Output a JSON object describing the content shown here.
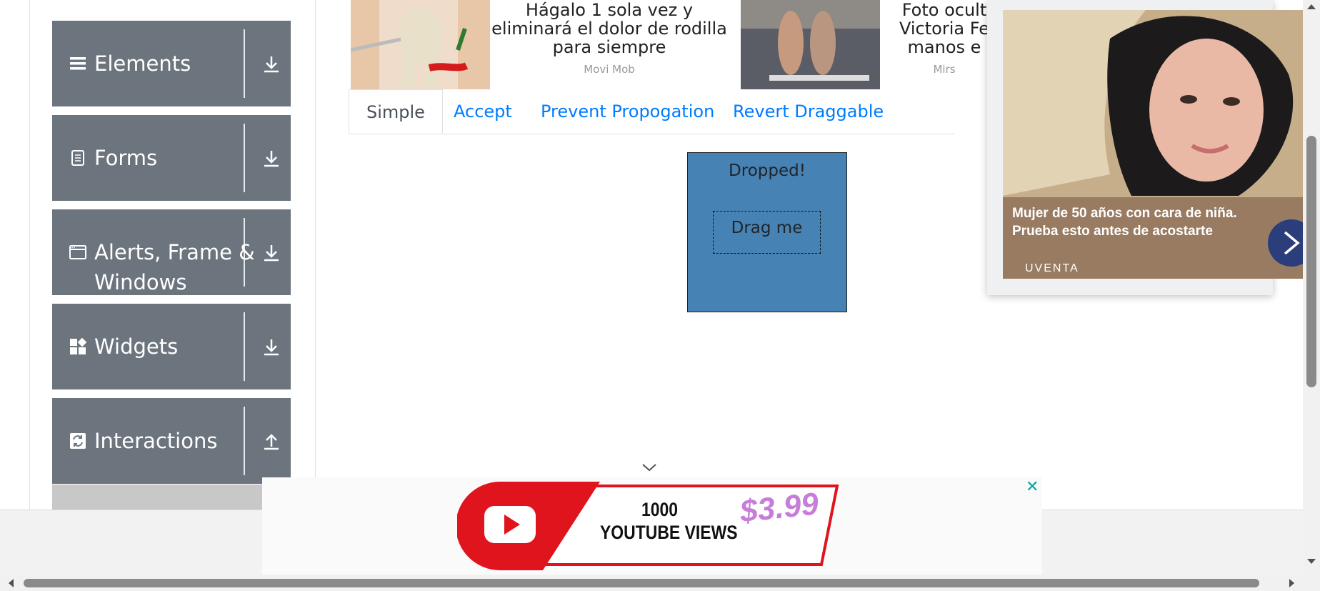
{
  "sidebar": {
    "groups": [
      {
        "label": "Elements",
        "icon": "list-icon",
        "state": "collapsed"
      },
      {
        "label": "Forms",
        "icon": "document-icon",
        "state": "collapsed"
      },
      {
        "label_line1": "Alerts, Frame &",
        "label_line2": "Windows",
        "icon": "window-icon",
        "state": "collapsed"
      },
      {
        "label": "Widgets",
        "icon": "widgets-icon",
        "state": "collapsed"
      },
      {
        "label": "Interactions",
        "icon": "interactions-icon",
        "state": "expanded"
      }
    ]
  },
  "top_ads": [
    {
      "title_line1": "Hágalo 1 sola vez y",
      "title_line2": "eliminará el dolor de rodilla",
      "title_line3": "para siempre",
      "source": "Movi Mob"
    },
    {
      "title_line1": "Foto ocult",
      "title_line2": "Victoria Fe",
      "title_line3": "manos e",
      "source": "Mirs"
    }
  ],
  "tabs": [
    {
      "label": "Simple",
      "active": true
    },
    {
      "label": "Accept",
      "active": false
    },
    {
      "label": "Prevent Propogation",
      "active": false
    },
    {
      "label": "Revert Draggable",
      "active": false
    }
  ],
  "droppable": {
    "text": "Dropped!",
    "color": "#4682b4"
  },
  "draggable": {
    "text": "Drag me"
  },
  "side_ad": {
    "text_line1": "Mujer de 50 años con cara de niña.",
    "text_line2": "Prueba esto antes de acostarte",
    "brand": "UVENTA"
  },
  "bottom_ad": {
    "line1": "1000",
    "line2": "YOUTUBE VIEWS",
    "price": "$3.99",
    "close": "✕"
  },
  "colors": {
    "sidebar_bg": "#6c757d",
    "tab_link": "#007bff",
    "youtube_red": "#e0141c"
  }
}
